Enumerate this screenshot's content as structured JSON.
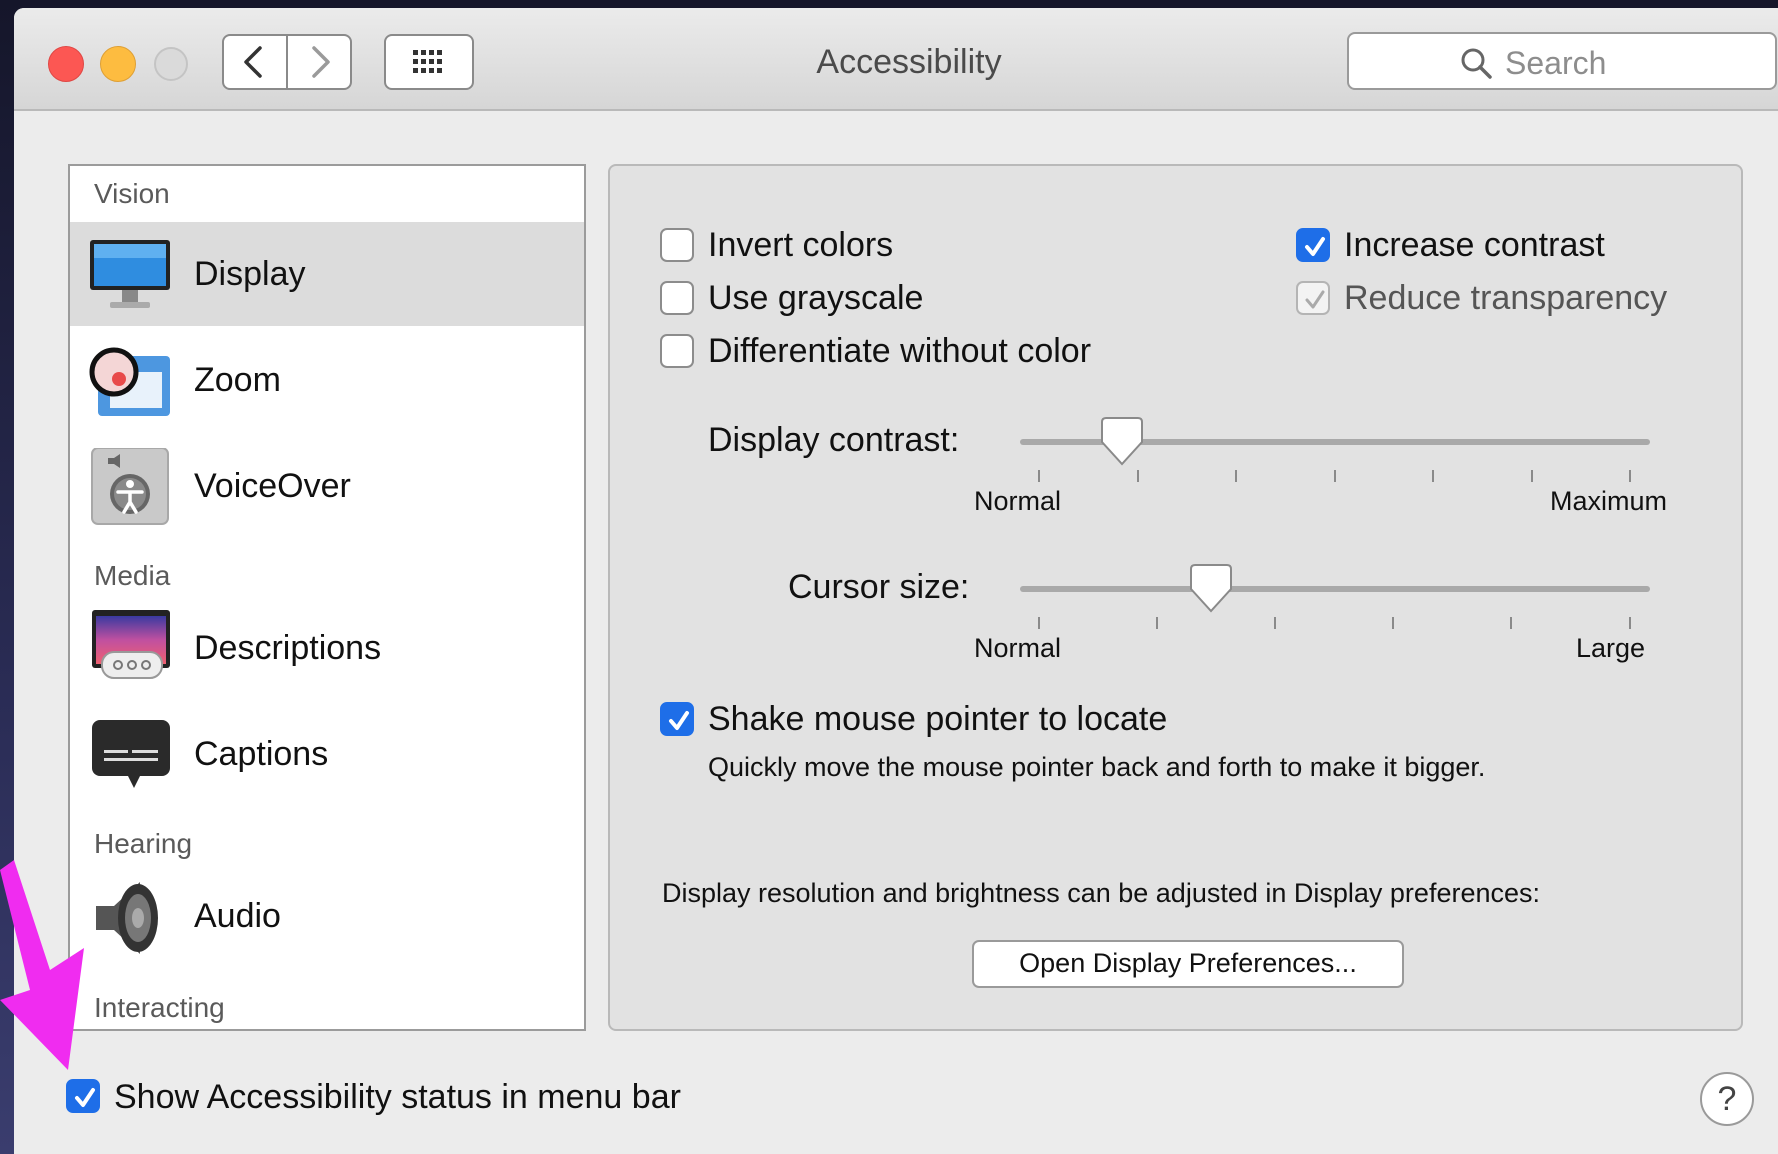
{
  "window": {
    "title": "Accessibility"
  },
  "toolbar": {
    "search_placeholder": "Search"
  },
  "sidebar": {
    "sections": [
      {
        "label": "Vision"
      },
      {
        "label": "Media"
      },
      {
        "label": "Hearing"
      },
      {
        "label": "Interacting"
      }
    ],
    "items": [
      {
        "label": "Display",
        "icon": "display-icon",
        "selected": true
      },
      {
        "label": "Zoom",
        "icon": "zoom-icon"
      },
      {
        "label": "VoiceOver",
        "icon": "voiceover-icon"
      },
      {
        "label": "Descriptions",
        "icon": "descriptions-icon"
      },
      {
        "label": "Captions",
        "icon": "captions-icon"
      },
      {
        "label": "Audio",
        "icon": "speaker-icon"
      }
    ]
  },
  "display": {
    "invert_colors": {
      "label": "Invert colors",
      "checked": false
    },
    "use_grayscale": {
      "label": "Use grayscale",
      "checked": false
    },
    "differentiate": {
      "label": "Differentiate without color",
      "checked": false
    },
    "increase_contrast": {
      "label": "Increase contrast",
      "checked": true
    },
    "reduce_transparency": {
      "label": "Reduce transparency",
      "checked": true,
      "disabled": true
    },
    "display_contrast": {
      "label": "Display contrast:",
      "min_label": "Normal",
      "max_label": "Maximum",
      "value_fraction": 0.14
    },
    "cursor_size": {
      "label": "Cursor size:",
      "min_label": "Normal",
      "max_label": "Large",
      "value_fraction": 0.29
    },
    "shake_pointer": {
      "label": "Shake mouse pointer to locate",
      "checked": true,
      "description": "Quickly move the mouse pointer back and forth to make it bigger."
    },
    "resolution_note": "Display resolution and brightness can be adjusted in Display preferences:",
    "open_prefs_button": "Open Display Preferences..."
  },
  "footer": {
    "show_status": {
      "label": "Show Accessibility status in menu bar",
      "checked": true
    },
    "help_label": "?"
  },
  "colors": {
    "accent": "#1e6ee8",
    "annotation_arrow": "#f02cf0"
  }
}
